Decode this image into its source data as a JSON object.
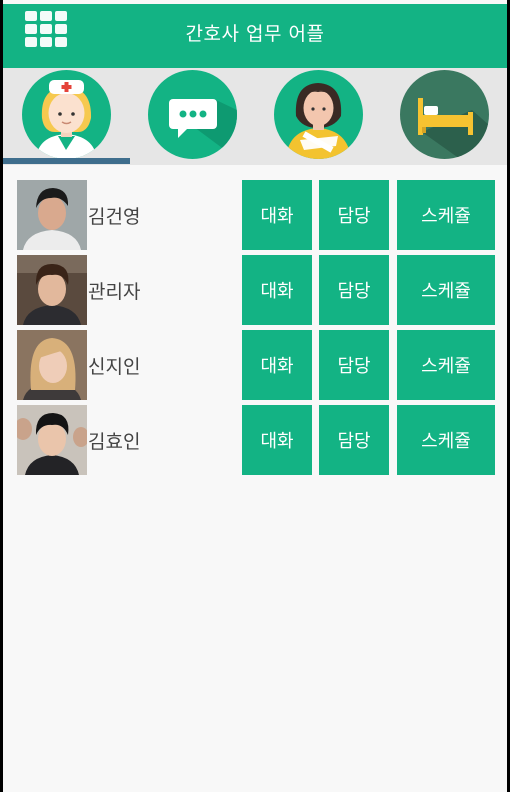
{
  "appbar": {
    "title": "간호사 업무 어플",
    "menu_icon": "grid-menu-icon"
  },
  "tabs": [
    {
      "name": "nurse",
      "icon": "nurse-icon",
      "bg": "#13b384"
    },
    {
      "name": "chat",
      "icon": "chat-bubble-icon",
      "bg": "#13b384"
    },
    {
      "name": "patient",
      "icon": "patient-icon",
      "bg": "#13b384"
    },
    {
      "name": "bed",
      "icon": "bed-icon",
      "bg": "#3a7860"
    }
  ],
  "selected_tab": 0,
  "colors": {
    "primary": "#13b384",
    "indicator": "#3f6e8d",
    "background": "#f8f8f8"
  },
  "staff": [
    {
      "name": "김건영",
      "chat_label": "대화",
      "charge_label": "담당",
      "schedule_label": "스케쥴"
    },
    {
      "name": "관리자",
      "chat_label": "대화",
      "charge_label": "담당",
      "schedule_label": "스케쥴"
    },
    {
      "name": "신지인",
      "chat_label": "대화",
      "charge_label": "담당",
      "schedule_label": "스케쥴"
    },
    {
      "name": "김효인",
      "chat_label": "대화",
      "charge_label": "담당",
      "schedule_label": "스케쥴"
    }
  ]
}
